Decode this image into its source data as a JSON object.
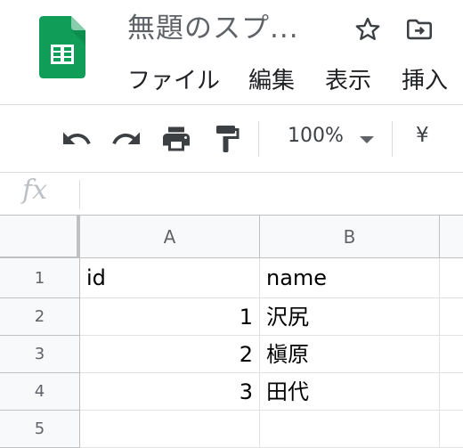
{
  "doc": {
    "title": "無題のスプ..."
  },
  "menu": [
    "ファイル",
    "編集",
    "表示",
    "挿入"
  ],
  "toolbar": {
    "zoom": "100%",
    "currency": "¥"
  },
  "formula_bar": {
    "fx_label": "fx",
    "value": ""
  },
  "grid": {
    "columns": [
      "A",
      "B"
    ],
    "rows": [
      {
        "num": "1",
        "a": "id",
        "b": "name"
      },
      {
        "num": "2",
        "a": "1",
        "b": "沢尻"
      },
      {
        "num": "3",
        "a": "2",
        "b": "槇原"
      },
      {
        "num": "4",
        "a": "3",
        "b": "田代"
      },
      {
        "num": "5",
        "a": "",
        "b": ""
      }
    ]
  },
  "colors": {
    "sheets_green": "#0f9d58",
    "sheets_dark_green": "#0b8043"
  }
}
